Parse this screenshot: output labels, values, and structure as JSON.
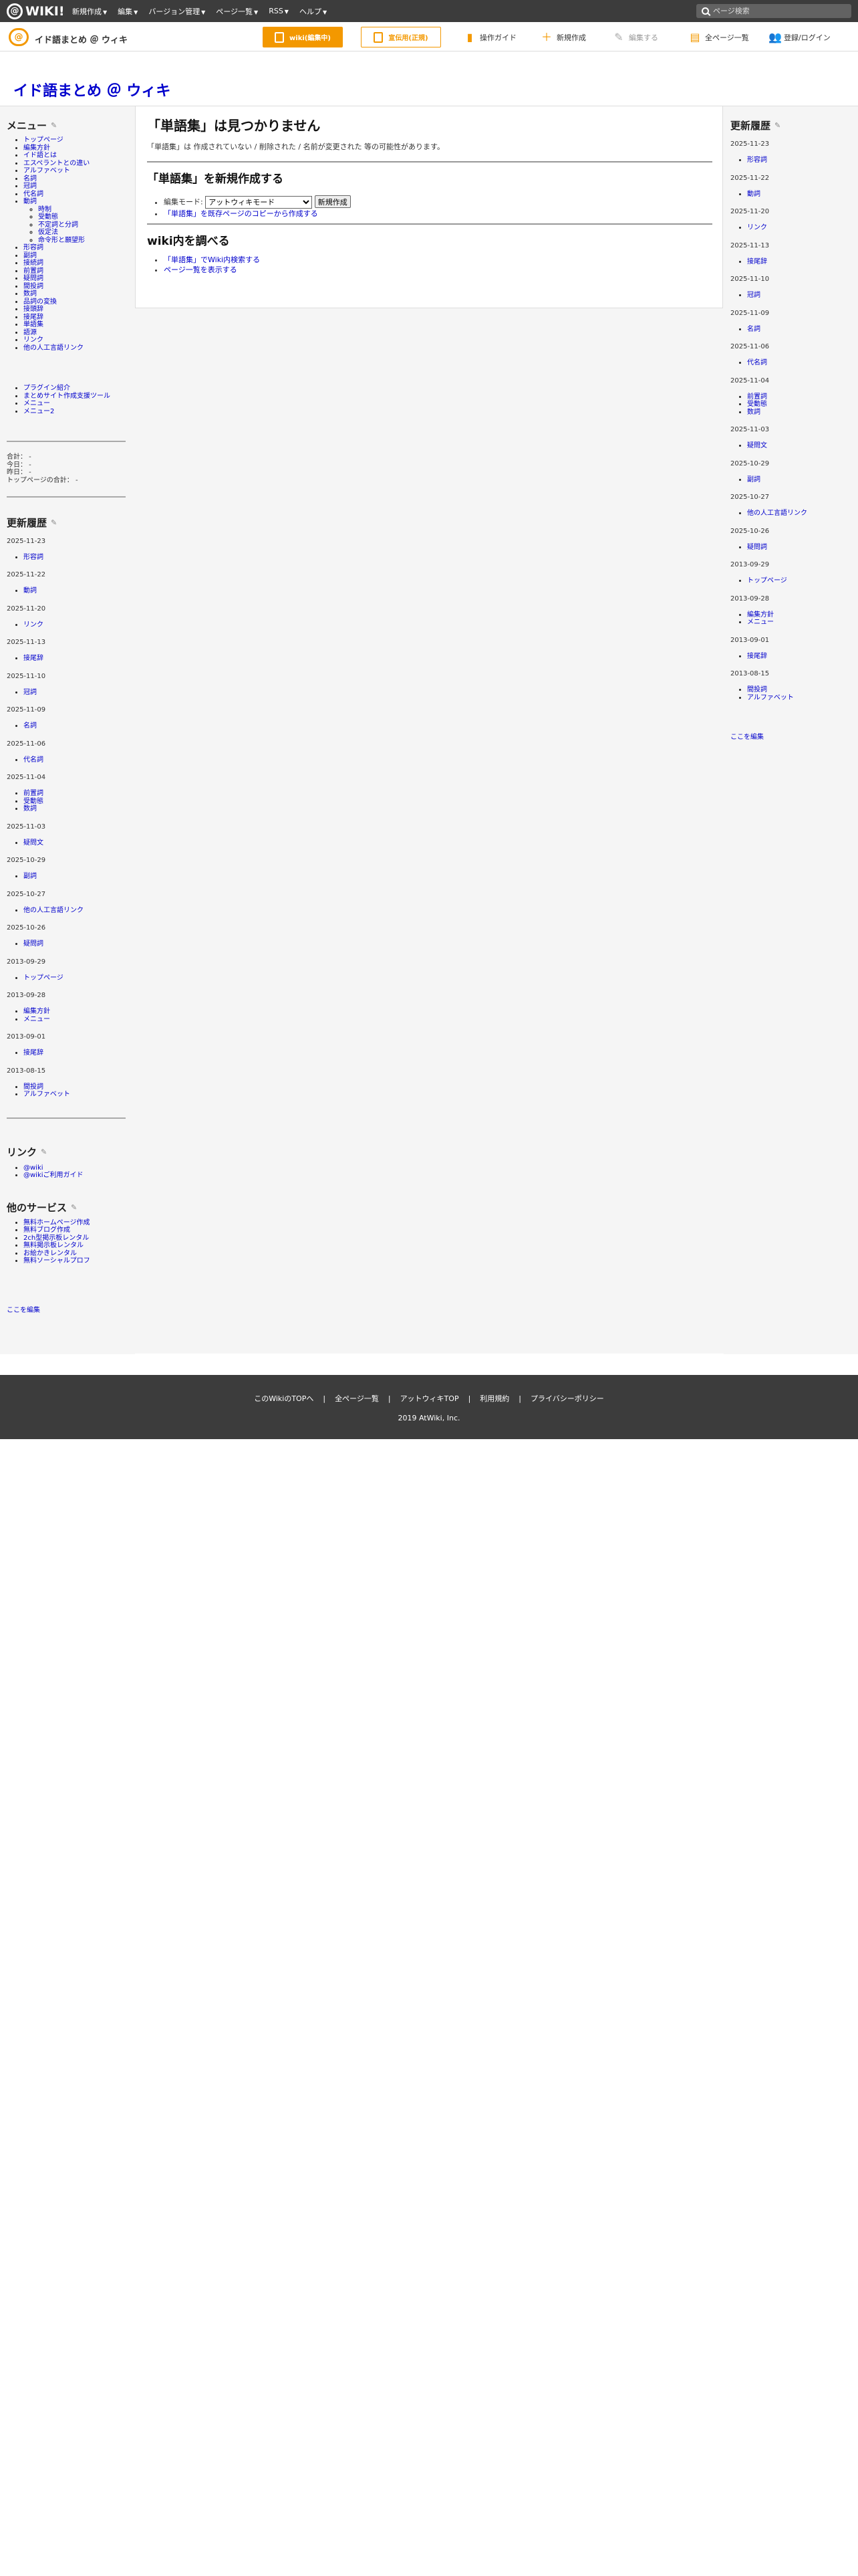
{
  "topbar": {
    "logo": "WIKI!",
    "menu": [
      "新規作成",
      "編集",
      "バージョン管理",
      "ページ一覧",
      "RSS",
      "ヘルプ"
    ],
    "search_placeholder": "ページ検索"
  },
  "subbar": {
    "wiki_title": "イド語まとめ ＠ ウィキ",
    "btn_edit": "wiki(編集中)",
    "btn_pub": "宣伝用(正規)",
    "tools": [
      "操作ガイド",
      "新規作成",
      "編集する",
      "全ページ一覧",
      "登録/ログイン"
    ]
  },
  "header": {
    "title": "イド語まとめ ＠ ウィキ"
  },
  "menu": {
    "heading": "メニュー",
    "items": [
      "トップページ",
      "編集方針",
      "イド語とは",
      "エスペラントとの違い",
      "アルファベット",
      "名詞",
      "冠詞",
      "代名詞",
      "動詞"
    ],
    "sub": [
      "時制",
      "受動態",
      "不定詞と分詞",
      "仮定法",
      "命令形と願望形"
    ],
    "items2": [
      "形容詞",
      "副詞",
      "接続詞",
      "前置詞",
      "疑問詞",
      "間投詞",
      "数詞",
      "品詞の変換",
      "接頭辞",
      "接尾辞",
      "単語集",
      "語源",
      "リンク",
      "他の人工言語リンク"
    ],
    "extra": [
      "プラグイン紹介",
      "まとめサイト作成支援ツール",
      "メニュー",
      "メニュー2"
    ]
  },
  "stats": [
    "合計： -",
    "今日： -",
    "昨日： -",
    "トップページの合計： -"
  ],
  "left_recent": {
    "heading": "更新履歴",
    "groups": [
      {
        "date": "2025-11-23",
        "items": [
          "形容詞"
        ]
      },
      {
        "date": "2025-11-22",
        "items": [
          "動詞"
        ]
      },
      {
        "date": "2025-11-20",
        "items": [
          "リンク"
        ]
      },
      {
        "date": "2025-11-13",
        "items": [
          "接尾辞"
        ]
      },
      {
        "date": "2025-11-10",
        "items": [
          "冠詞"
        ]
      },
      {
        "date": "2025-11-09",
        "items": [
          "名詞"
        ]
      },
      {
        "date": "2025-11-06",
        "items": [
          "代名詞"
        ]
      },
      {
        "date": "2025-11-04",
        "items": [
          "前置詞",
          "受動態",
          "数詞"
        ]
      },
      {
        "date": "2025-11-03",
        "items": [
          "疑問文"
        ]
      },
      {
        "date": "2025-10-29",
        "items": [
          "副詞"
        ]
      },
      {
        "date": "2025-10-27",
        "items": [
          "他の人工言語リンク"
        ]
      },
      {
        "date": "2025-10-26",
        "items": [
          "疑問詞"
        ]
      },
      {
        "date": "2013-09-29",
        "items": [
          "トップページ"
        ]
      },
      {
        "date": "2013-09-28",
        "items": [
          "編集方針",
          "メニュー"
        ]
      },
      {
        "date": "2013-09-01",
        "items": [
          "接尾辞"
        ]
      },
      {
        "date": "2013-08-15",
        "items": [
          "間投詞",
          "アルファベット"
        ]
      }
    ]
  },
  "links": {
    "heading": "リンク",
    "items": [
      "@wiki",
      "@wikiご利用ガイド"
    ]
  },
  "services": {
    "heading": "他のサービス",
    "items": [
      "無料ホームページ作成",
      "無料ブログ作成",
      "2ch型掲示板レンタル",
      "無料掲示板レンタル",
      "お絵かきレンタル",
      "無料ソーシャルプロフ"
    ]
  },
  "edit_here": "ここを編集",
  "main": {
    "h2": "「単語集」は見つかりません",
    "desc": "「単語集」は 作成されていない / 削除された / 名前が変更された 等の可能性があります。",
    "h3a": "「単語集」を新規作成する",
    "mode_label": "編集モード:",
    "mode_value": "アットウィキモード",
    "create_btn": "新規作成",
    "copy_link": "「単語集」を既存ページのコピーから作成する",
    "h3b": "wiki内を調べる",
    "search_link": "「単語集」でWiki内検索する",
    "list_link": "ページ一覧を表示する"
  },
  "footer": {
    "links": [
      "このWikiのTOPへ",
      "全ページ一覧",
      "アットウィキTOP",
      "利用規約",
      "プライバシーポリシー"
    ],
    "copy": "2019 AtWiki, Inc."
  }
}
